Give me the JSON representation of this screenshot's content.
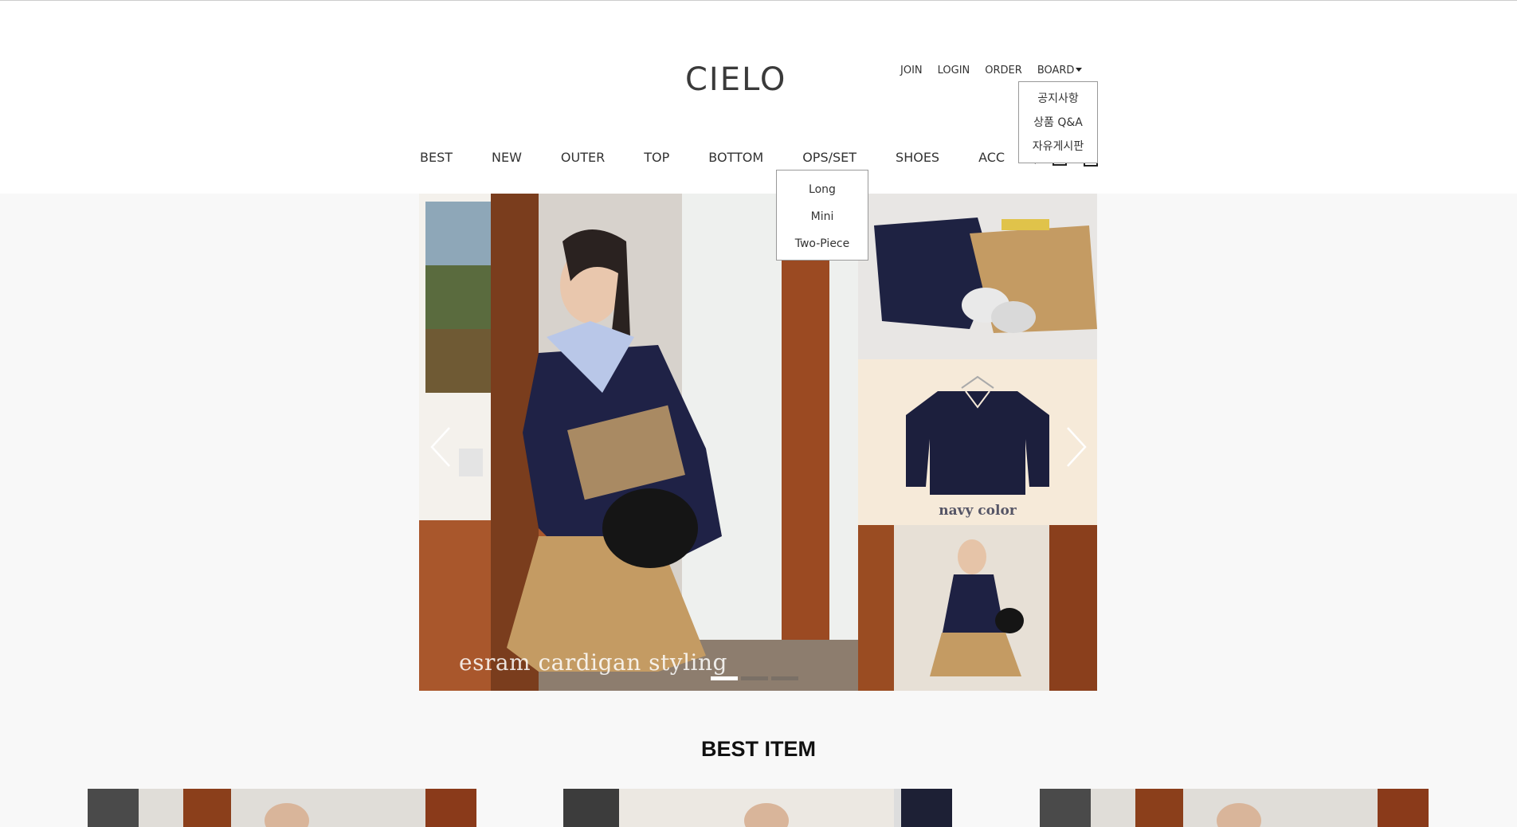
{
  "header": {
    "logo": "CIELO",
    "top_links": [
      "JOIN",
      "LOGIN",
      "ORDER",
      "BOARD"
    ],
    "board_menu": [
      "공지사항",
      "상품 Q&A",
      "자유게시판"
    ],
    "nav": [
      "BEST",
      "NEW",
      "OUTER",
      "TOP",
      "BOTTOM",
      "OPS/SET",
      "SHOES",
      "ACC"
    ],
    "ops_submenu": [
      "Long",
      "Mini",
      "Two-Piece"
    ],
    "util_icons": [
      "search-icon",
      "account-icon",
      "cart-icon"
    ]
  },
  "slider": {
    "caption": "esram cardigan styling",
    "side_caption": "navy color",
    "slide_count": 3,
    "active_slide": 1
  },
  "best": {
    "title": "BEST ITEM"
  }
}
